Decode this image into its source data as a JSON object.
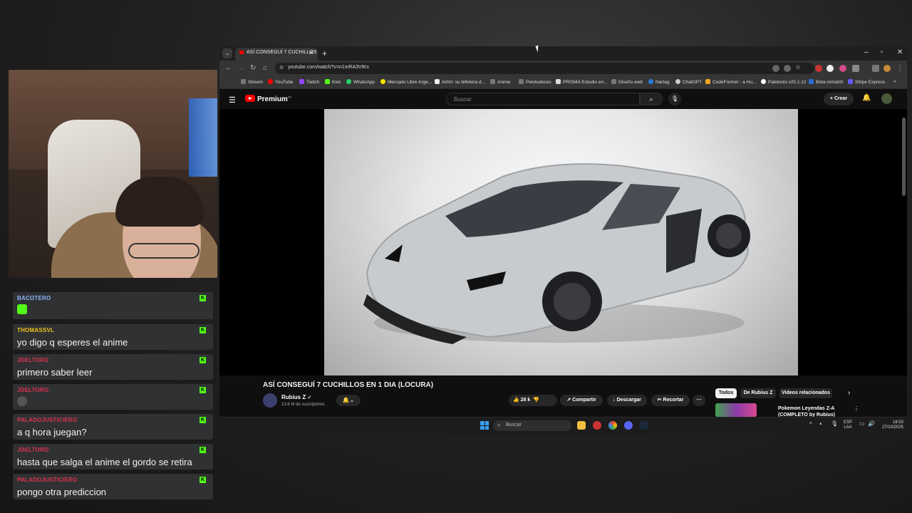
{
  "chat": {
    "messages": [
      {
        "user": "BACOTERO",
        "text": "",
        "user_color": "#8ab4f8",
        "emote": true
      },
      {
        "user": "THOMASSVL",
        "text": "yo digo q esperes el anime",
        "user_color": "#f0c419"
      },
      {
        "user": "JDELTORO",
        "text": "primero saber leer",
        "user_color": "#e0334f"
      },
      {
        "user": "JDELTORO",
        "text": "",
        "user_color": "#e0334f",
        "emote": true
      },
      {
        "user": "PALADOJUSTICIERO",
        "text": "a q hora juegan?",
        "user_color": "#e0334f"
      },
      {
        "user": "JDELTORO",
        "text": "hasta que salga el anime el gordo se retira",
        "user_color": "#e0334f"
      },
      {
        "user": "PALADOJUSTICIERO",
        "text": "pongo otra prediccion",
        "user_color": "#e0334f"
      }
    ],
    "badge_label": "K",
    "accent": "#53fc18"
  },
  "browser": {
    "tab_title": "ASÍ CONSEGUÍ 7 CUCHILLOS",
    "url": "youtube.com/watch?v=n1mRA3VtKs",
    "bookmarks": [
      "Stream",
      "YouTube",
      "Twitch",
      "Kick",
      "WhatsApp",
      "Mercado Libre Arge...",
      "Airtm: su billetera d...",
      "Anime",
      "Pelotudeces",
      "PRISMA Estudio en...",
      "Diseño web",
      "Nartag",
      "ChatGPT",
      "CodeFormer - a Hu...",
      "Paletools v25.1.12",
      "Beta rematch",
      "Stripe Express"
    ]
  },
  "youtube": {
    "logo": "Premium",
    "logo_sup": "AR",
    "search_placeholder": "Buscar",
    "create_label": "Crear",
    "video_title": "ASÍ CONSEGUÍ 7 CUCHILLOS EN 1 DIA (LOCURA)",
    "channel_name": "Rubius Z",
    "channel_subs": "13.6 M de suscriptores",
    "likes": "28 k",
    "share": "Compartir",
    "download": "Descargar",
    "clip": "Recortar",
    "chips": [
      "Todos",
      "De Rubius Z",
      "Videos relacionados"
    ],
    "rec_title": "Pokemon Leyendas Z-A (COMPLETO by Rubius)"
  },
  "taskbar": {
    "search_placeholder": "Buscar",
    "lang_top": "ESP",
    "lang_bottom": "LAA",
    "time": "18:53",
    "date": "27/10/2025"
  }
}
